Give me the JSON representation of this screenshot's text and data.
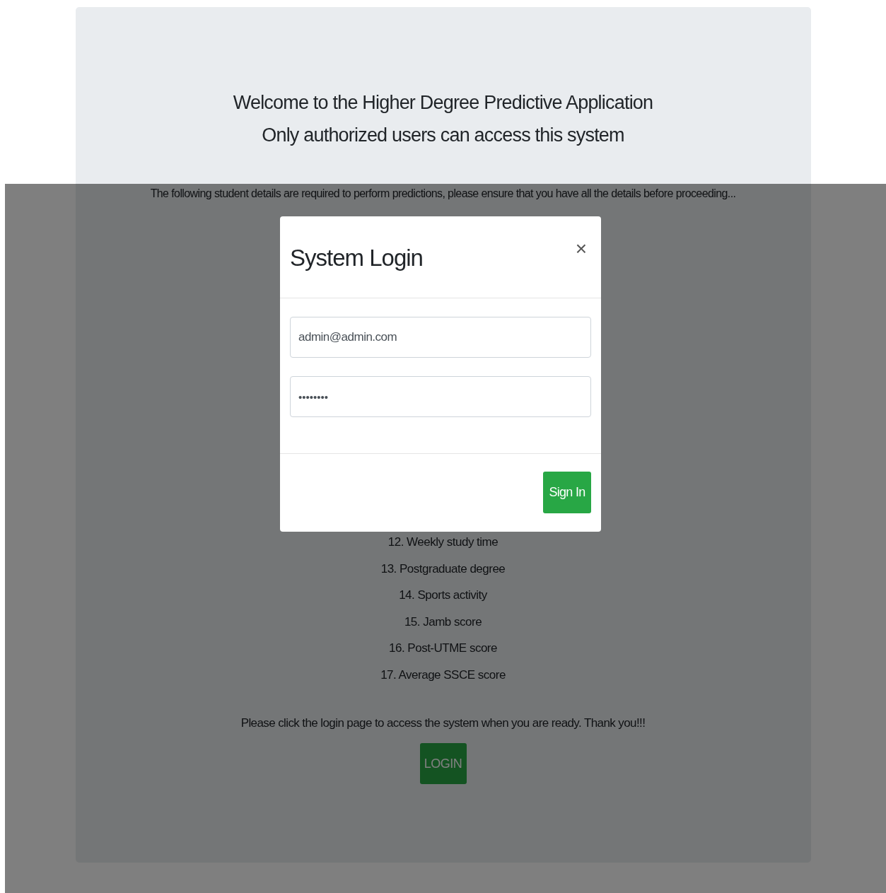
{
  "header": {
    "lines": [
      "Welcome to the Higher Degree Predictive Application",
      "Only authorized users can access this system"
    ]
  },
  "intro": "The following student details are required to perform predictions, please ensure that you have all the details before proceeding...",
  "requirements": [
    "12. Weekly study time",
    "13. Postgraduate degree",
    "14. Sports activity",
    "15. Jamb score",
    "16. Post-UTME score",
    "17. Average SSCE score"
  ],
  "closing": "Please click the login page to access the system when you are ready. Thank you!!!",
  "login_button": "LOGIN",
  "modal": {
    "title": "System Login",
    "close": "×",
    "fields": [
      {
        "kind": "email",
        "value": "admin@admin.com"
      },
      {
        "kind": "password",
        "value": "••••••••"
      }
    ],
    "submit": "Sign In"
  }
}
